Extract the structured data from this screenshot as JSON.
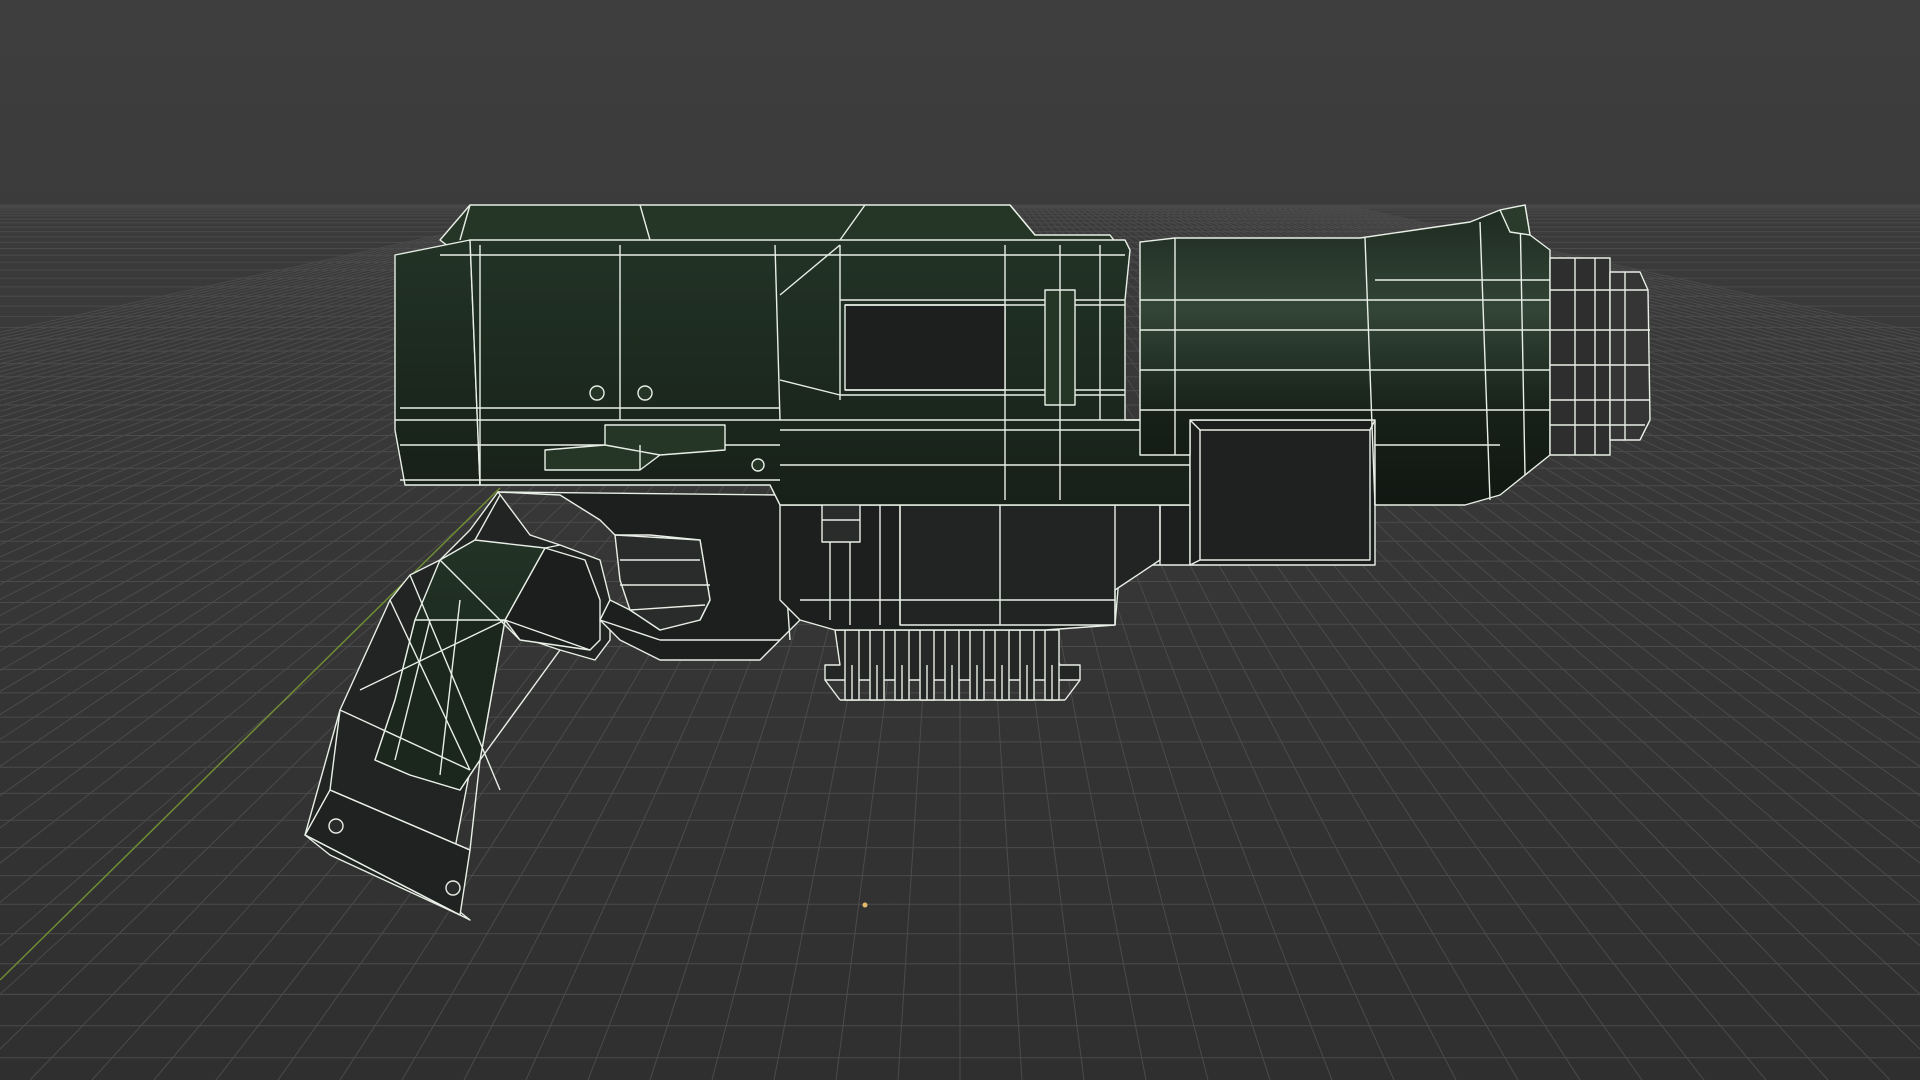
{
  "viewport": {
    "mode": "wireframe",
    "background_top": "#3d3d3d",
    "background_bottom": "#2e2e2e",
    "grid_color": "#4a4a4a",
    "axis_y_color": "#6f8c33",
    "wire_color": "#e8efe6",
    "body_fill": "#1c2a1f",
    "body_fill_light": "#2b3d2e",
    "dark_fill": "#1e1f1f",
    "origin_color": "#e6b86a"
  },
  "model": {
    "object": "pistol-mesh",
    "origin_marker": "object-origin"
  }
}
